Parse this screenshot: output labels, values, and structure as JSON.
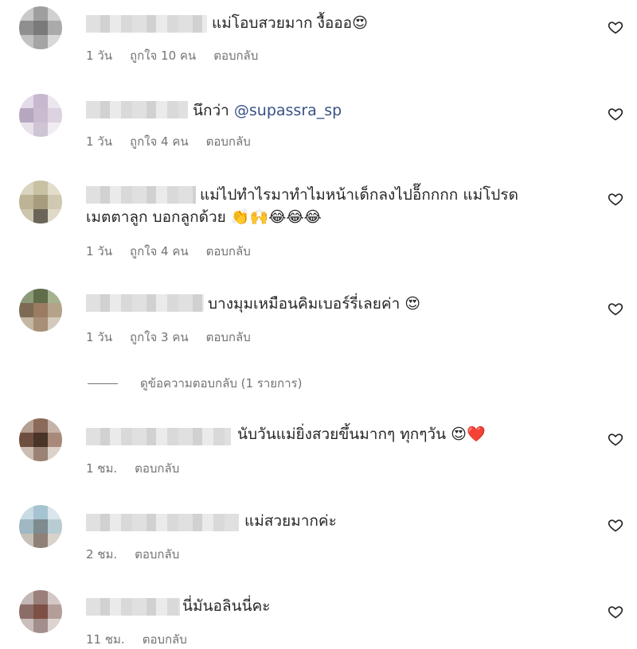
{
  "comments": [
    {
      "text": "แม่โอบสวยมาก งื้อออ😍",
      "time": "1 วัน",
      "likes": "ถูกใจ 10 คน",
      "reply": "ตอบกลับ"
    },
    {
      "text": "นึกว่า ",
      "mention": "@supassra_sp",
      "time": "1 วัน",
      "likes": "ถูกใจ 4 คน",
      "reply": "ตอบกลับ"
    },
    {
      "text": "แม่ไปทำไรมาทำไมหน้าเด็กลงไปอ็๊กกกก แม่โปรด",
      "text2": "เมตตาลูก บอกลูกด้วย 👏🙌😂😂😂",
      "time": "1 วัน",
      "likes": "ถูกใจ 4 คน",
      "reply": "ตอบกลับ"
    },
    {
      "text": "บางมุมเหมือนคิมเบอร์รี่เลยค่า 😍",
      "time": "1 วัน",
      "likes": "ถูกใจ 3 คน",
      "reply": "ตอบกลับ"
    },
    {
      "text": "นับวันแม่ยิ่งสวยขึ้นมากๆ ทุกๆวัน 😍❤️",
      "time": "1 ชม.",
      "reply": "ตอบกลับ"
    },
    {
      "text": "แม่สวยมากค่ะ",
      "time": "2 ชม.",
      "reply": "ตอบกลับ"
    },
    {
      "text": "นี่มันอลินนี่คะ",
      "time": "11 ชม.",
      "reply": "ตอบกลับ"
    }
  ],
  "view_replies": "ดูข้อความตอบกลับ (1 รายการ)",
  "icons": {
    "like": "heart-outline-icon"
  }
}
